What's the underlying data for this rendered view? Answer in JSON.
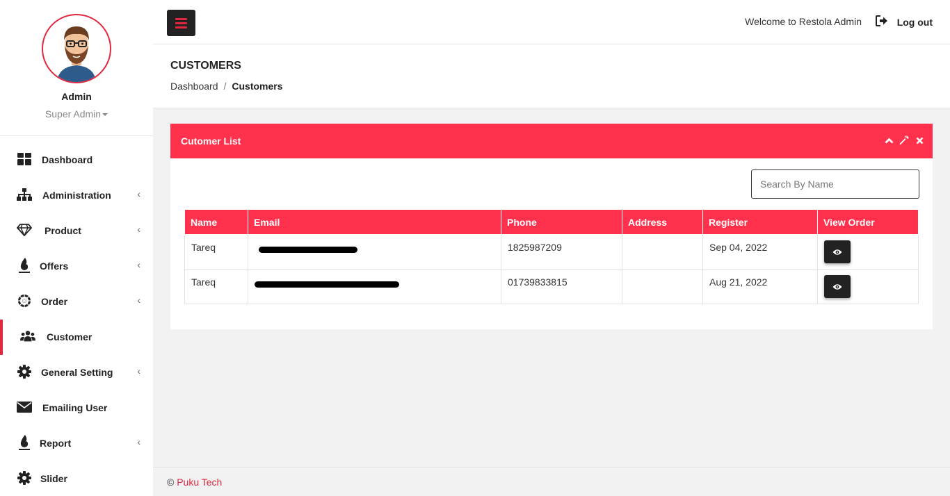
{
  "profile": {
    "name": "Admin",
    "role": "Super Admin"
  },
  "sidebar": {
    "items": [
      {
        "label": "Dashboard",
        "icon": "dashboard-icon",
        "has_arrow": false
      },
      {
        "label": "Administration",
        "icon": "sitemap-icon",
        "has_arrow": true
      },
      {
        "label": "Product",
        "icon": "diamond-icon",
        "has_arrow": true
      },
      {
        "label": "Offers",
        "icon": "fire-icon",
        "has_arrow": true
      },
      {
        "label": "Order",
        "icon": "spinner-icon",
        "has_arrow": true
      },
      {
        "label": "Customer",
        "icon": "users-icon",
        "has_arrow": false,
        "active": true
      },
      {
        "label": "General Setting",
        "icon": "gear-icon",
        "has_arrow": true
      },
      {
        "label": "Emailing User",
        "icon": "envelope-icon",
        "has_arrow": false
      },
      {
        "label": "Report",
        "icon": "fire-icon",
        "has_arrow": true
      },
      {
        "label": "Slider",
        "icon": "gear-icon",
        "has_arrow": false
      }
    ],
    "arrow": "‹"
  },
  "topbar": {
    "welcome": "Welcome to Restola Admin",
    "logout": "Log out"
  },
  "page": {
    "title": "CUSTOMERS",
    "breadcrumb": [
      "Dashboard",
      "Customers"
    ],
    "separator": "/"
  },
  "panel": {
    "title": "Cutomer List",
    "search_placeholder": "Search By Name",
    "columns": [
      "Name",
      "Email",
      "Phone",
      "Address",
      "Register",
      "View Order"
    ],
    "rows": [
      {
        "name": "Tareq",
        "email": "[redacted]",
        "phone": "1825987209",
        "address": "",
        "register": "Sep 04, 2022"
      },
      {
        "name": "Tareq",
        "email": "[redacted]",
        "phone": "01739833815",
        "address": "",
        "register": "Aug 21, 2022"
      }
    ]
  },
  "footer": {
    "copyright": "©",
    "company": "Puku Tech"
  },
  "colors": {
    "accent": "#ff314c",
    "active_border": "#e0283f",
    "dark": "#222222"
  }
}
